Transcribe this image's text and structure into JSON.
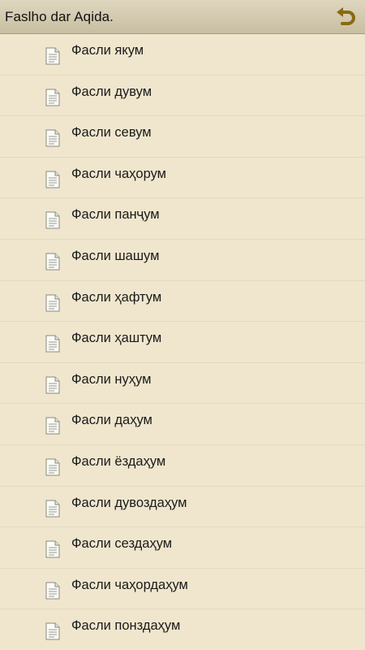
{
  "header": {
    "title": "Faslho dar Aqida.",
    "back_icon": "undo-arrow-icon"
  },
  "list": {
    "item_icon": "document-icon",
    "items": [
      {
        "label": "Фасли якум"
      },
      {
        "label": "Фасли дувум"
      },
      {
        "label": "Фасли севум"
      },
      {
        "label": "Фасли чаҳорум"
      },
      {
        "label": "Фасли панҷум"
      },
      {
        "label": "Фасли шашум"
      },
      {
        "label": "Фасли ҳафтум"
      },
      {
        "label": "Фасли ҳаштум"
      },
      {
        "label": "Фасли нуҳум"
      },
      {
        "label": "Фасли даҳум"
      },
      {
        "label": "Фасли ёздаҳум"
      },
      {
        "label": "Фасли дувоздаҳум"
      },
      {
        "label": "Фасли сездаҳум"
      },
      {
        "label": "Фасли чаҳордаҳум"
      },
      {
        "label": "Фасли понздаҳум"
      }
    ]
  },
  "colors": {
    "background": "#efe6cd",
    "header_top": "#dfd6bf",
    "header_bottom": "#c8bea1",
    "back_arrow": "#8a6a10"
  }
}
